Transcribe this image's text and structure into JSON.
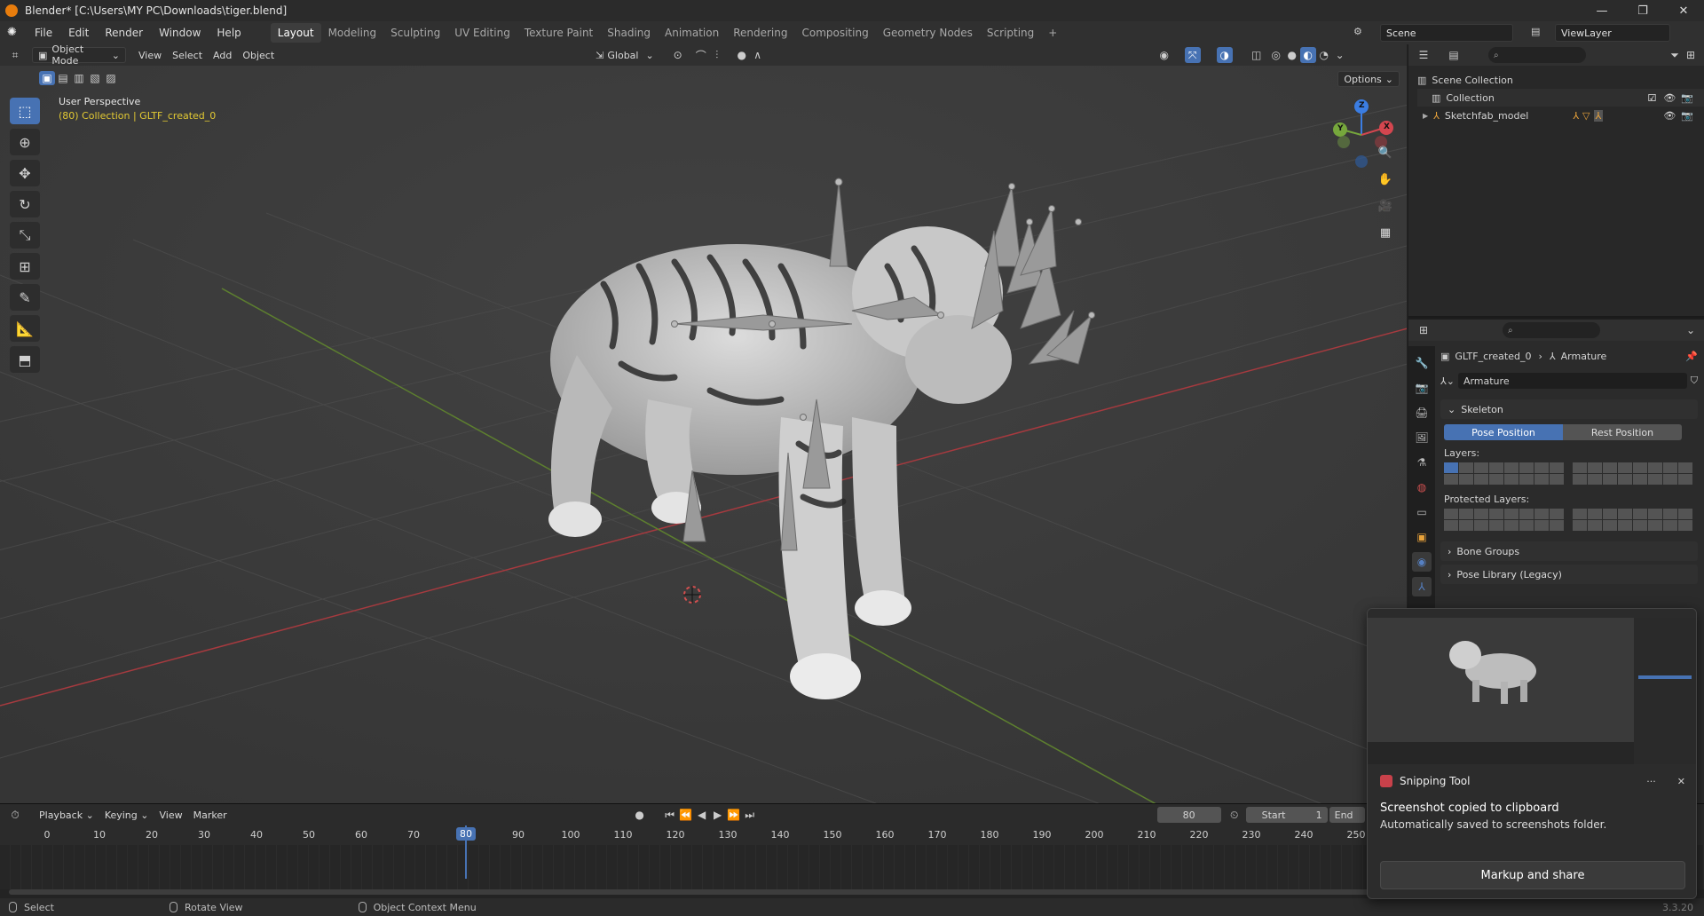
{
  "titlebar": {
    "title": "Blender* [C:\\Users\\MY PC\\Downloads\\tiger.blend]",
    "minimize": "—",
    "maximize": "❐",
    "close": "✕"
  },
  "menus": [
    "File",
    "Edit",
    "Render",
    "Window",
    "Help"
  ],
  "workspaces": [
    {
      "label": "Layout",
      "active": true
    },
    {
      "label": "Modeling"
    },
    {
      "label": "Sculpting"
    },
    {
      "label": "UV Editing"
    },
    {
      "label": "Texture Paint"
    },
    {
      "label": "Shading"
    },
    {
      "label": "Animation"
    },
    {
      "label": "Rendering"
    },
    {
      "label": "Compositing"
    },
    {
      "label": "Geometry Nodes"
    },
    {
      "label": "Scripting"
    }
  ],
  "add_workspace": "+",
  "scene": {
    "name": "Scene",
    "view_layer": "ViewLayer"
  },
  "viewport_header": {
    "mode": "Object Mode",
    "menus": [
      "View",
      "Select",
      "Add",
      "Object"
    ],
    "orientation": "Global",
    "options": "Options"
  },
  "viewport_overlay": {
    "view_name": "User Perspective",
    "collection_info": "(80) Collection | GLTF_created_0"
  },
  "gizmo_axes": {
    "x": "X",
    "y": "Y",
    "z": "Z"
  },
  "colors": {
    "accent": "#4772b3",
    "x_axis": "#d4464f",
    "y_axis": "#76a73c",
    "z_axis": "#3b7de2",
    "overlay_yellow": "#e2c933"
  },
  "outliner": {
    "root": "Scene Collection",
    "items": [
      {
        "label": "Collection"
      },
      {
        "label": "Sketchfab_model"
      }
    ]
  },
  "properties": {
    "breadcrumb_object": "GLTF_created_0",
    "breadcrumb_data": "Armature",
    "datablock_name": "Armature",
    "skeleton_label": "Skeleton",
    "pose_position": "Pose Position",
    "rest_position": "Rest Position",
    "layers_label": "Layers:",
    "protected_layers_label": "Protected Layers:",
    "bone_groups": "Bone Groups",
    "pose_library": "Pose Library (Legacy)"
  },
  "timeline": {
    "menus": [
      "Playback",
      "Keying",
      "View",
      "Marker"
    ],
    "current_frame": "80",
    "start_label": "Start",
    "start_value": "1",
    "end_label": "End",
    "ticks": [
      "0",
      "10",
      "20",
      "30",
      "40",
      "50",
      "60",
      "70",
      "80",
      "90",
      "100",
      "110",
      "120",
      "130",
      "140",
      "150",
      "160",
      "170",
      "180",
      "190",
      "200",
      "210",
      "220",
      "230",
      "240",
      "250"
    ]
  },
  "statusbar": {
    "select": "Select",
    "rotate": "Rotate View",
    "context": "Object Context Menu",
    "version": "3.3.20"
  },
  "snipping": {
    "app": "Snipping Tool",
    "more": "···",
    "close": "✕",
    "line1": "Screenshot copied to clipboard",
    "line2": "Automatically saved to screenshots folder.",
    "button": "Markup and share"
  }
}
